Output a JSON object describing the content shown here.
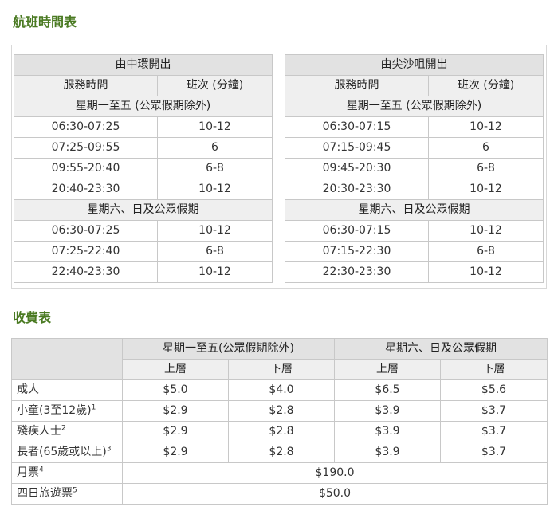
{
  "schedule_title": "航班時間表",
  "fare_title": "收費表",
  "schedule_central": {
    "heading": "由中環開出",
    "col_time": "服務時間",
    "col_freq": "班次 (分鐘)",
    "weekday_label": "星期一至五 (公眾假期除外)",
    "weekday_rows": [
      {
        "time": "06:30-07:25",
        "freq": "10-12"
      },
      {
        "time": "07:25-09:55",
        "freq": "6"
      },
      {
        "time": "09:55-20:40",
        "freq": "6-8"
      },
      {
        "time": "20:40-23:30",
        "freq": "10-12"
      }
    ],
    "weekend_label": "星期六、日及公眾假期",
    "weekend_rows": [
      {
        "time": "06:30-07:25",
        "freq": "10-12"
      },
      {
        "time": "07:25-22:40",
        "freq": "6-8"
      },
      {
        "time": "22:40-23:30",
        "freq": "10-12"
      }
    ]
  },
  "schedule_tst": {
    "heading": "由尖沙咀開出",
    "col_time": "服務時間",
    "col_freq": "班次 (分鐘)",
    "weekday_label": "星期一至五 (公眾假期除外)",
    "weekday_rows": [
      {
        "time": "06:30-07:15",
        "freq": "10-12"
      },
      {
        "time": "07:15-09:45",
        "freq": "6"
      },
      {
        "time": "09:45-20:30",
        "freq": "6-8"
      },
      {
        "time": "20:30-23:30",
        "freq": "10-12"
      }
    ],
    "weekend_label": "星期六、日及公眾假期",
    "weekend_rows": [
      {
        "time": "06:30-07:15",
        "freq": "10-12"
      },
      {
        "time": "07:15-22:30",
        "freq": "6-8"
      },
      {
        "time": "22:30-23:30",
        "freq": "10-12"
      }
    ]
  },
  "fare": {
    "group_weekday": "星期一至五(公眾假期除外)",
    "group_weekend": "星期六、日及公眾假期",
    "upper": "上層",
    "lower": "下層",
    "rows": [
      {
        "label": "成人",
        "sup": "",
        "wd_upper": "$5.0",
        "wd_lower": "$4.0",
        "we_upper": "$6.5",
        "we_lower": "$5.6"
      },
      {
        "label": "小童(3至12歲)",
        "sup": "1",
        "wd_upper": "$2.9",
        "wd_lower": "$2.8",
        "we_upper": "$3.9",
        "we_lower": "$3.7"
      },
      {
        "label": "殘疾人士",
        "sup": "2",
        "wd_upper": "$2.9",
        "wd_lower": "$2.8",
        "we_upper": "$3.9",
        "we_lower": "$3.7"
      },
      {
        "label": "長者(65歲或以上)",
        "sup": "3",
        "wd_upper": "$2.9",
        "wd_lower": "$2.8",
        "we_upper": "$3.9",
        "we_lower": "$3.7"
      }
    ],
    "monthly": {
      "label": "月票",
      "sup": "4",
      "value": "$190.0"
    },
    "tourist": {
      "label": "四日旅遊票",
      "sup": "5",
      "value": "$50.0"
    }
  }
}
